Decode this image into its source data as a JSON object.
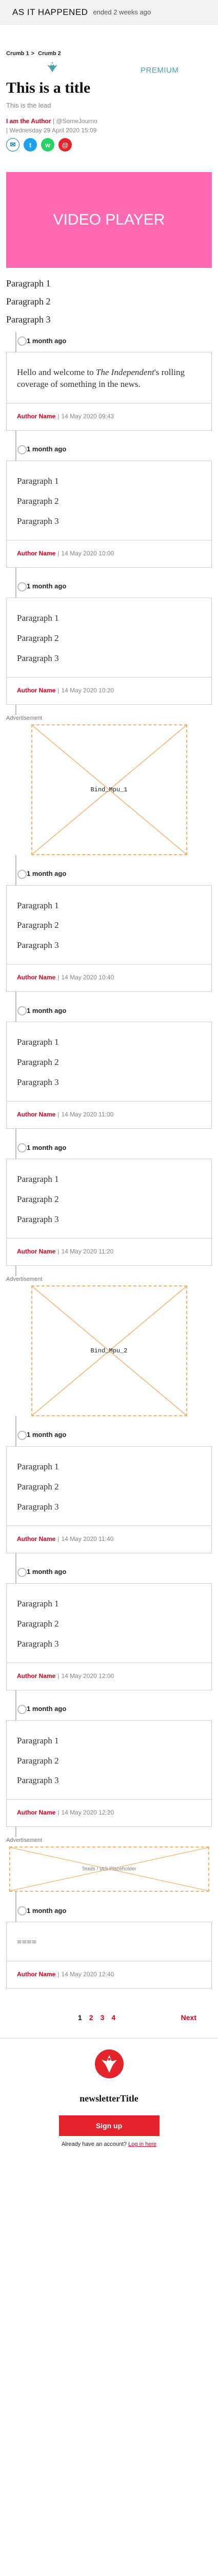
{
  "sticky": {
    "status": "As it happened",
    "meta": "ended 2 weeks ago"
  },
  "header": {
    "breadcrumbs": [
      "Crumb 1",
      "Crumb 2"
    ],
    "premium": "Premium",
    "title": "This is a title",
    "lead": "This is the lead",
    "author": "I am the Author",
    "handle": "@SomeJourno",
    "date": "Wednesday 29 April 2020 15:09"
  },
  "share": {
    "icons": [
      "mail-icon",
      "twitter-icon",
      "whatsapp-icon",
      "email-icon"
    ],
    "glyphs": [
      "✉",
      "t",
      "w",
      "@"
    ]
  },
  "video": {
    "label": "Video player"
  },
  "intro_paragraphs": [
    "Paragraph 1",
    "Paragraph 2",
    "Paragraph 3"
  ],
  "entries": [
    {
      "time": "1 month ago",
      "body": [
        "Hello and welcome to ",
        "The Independent",
        "'s rolling coverage of something in the news."
      ],
      "author": "Author Name",
      "stamp": "14 May 2020 09:43"
    },
    {
      "time": "1 month ago",
      "paragraphs": [
        "Paragraph 1",
        "Paragraph 2",
        "Paragraph 3"
      ],
      "author": "Author Name",
      "stamp": "14 May 2020 10:00"
    },
    {
      "time": "1 month ago",
      "paragraphs": [
        "Paragraph 1",
        "Paragraph 2",
        "Paragraph 3"
      ],
      "author": "Author Name",
      "stamp": "14 May 2020 10:20"
    },
    {
      "time": "1 month ago",
      "paragraphs": [
        "Paragraph 1",
        "Paragraph 2",
        "Paragraph 3"
      ],
      "author": "Author Name",
      "stamp": "14 May 2020 10:40"
    },
    {
      "time": "1 month ago",
      "paragraphs": [
        "Paragraph 1",
        "Paragraph 2",
        "Paragraph 3"
      ],
      "author": "Author Name",
      "stamp": "14 May 2020 11:00"
    },
    {
      "time": "1 month ago",
      "paragraphs": [
        "Paragraph 1",
        "Paragraph 2",
        "Paragraph 3"
      ],
      "author": "Author Name",
      "stamp": "14 May 2020 11:20"
    },
    {
      "time": "1 month ago",
      "paragraphs": [
        "Paragraph 1",
        "Paragraph 2",
        "Paragraph 3"
      ],
      "author": "Author Name",
      "stamp": "14 May 2020 11:40"
    },
    {
      "time": "1 month ago",
      "paragraphs": [
        "Paragraph 1",
        "Paragraph 2",
        "Paragraph 3"
      ],
      "author": "Author Name",
      "stamp": "14 May 2020 12:00"
    },
    {
      "time": "1 month ago",
      "paragraphs": [
        "Paragraph 1",
        "Paragraph 2",
        "Paragraph 3"
      ],
      "author": "Author Name",
      "stamp": "14 May 2020 12:20"
    },
    {
      "time": "1 month ago",
      "paragraphs": [
        "===="
      ],
      "author": "Author Name",
      "stamp": "14 May 2020 12:40"
    }
  ],
  "ads": [
    {
      "label": "Advertisement",
      "id": "Bind_Mpu_1"
    },
    {
      "label": "Advertisement",
      "id": "Bind_Mpu_2"
    },
    {
      "label": "Advertisement",
      "id": "Teads / IAS Placeholder"
    }
  ],
  "pager": {
    "pages": [
      "1",
      "2",
      "3",
      "4"
    ],
    "current": "1",
    "next": "Next"
  },
  "newsletter": {
    "title": "newsletterTitle",
    "button": "Sign up",
    "login_prompt": "Already have an account?",
    "login_link": "Log in here"
  },
  "colors": {
    "accent": "#d6001c",
    "video": "#ff69b4",
    "premium": "#43a3a8",
    "ad_border": "#f6b26b"
  }
}
